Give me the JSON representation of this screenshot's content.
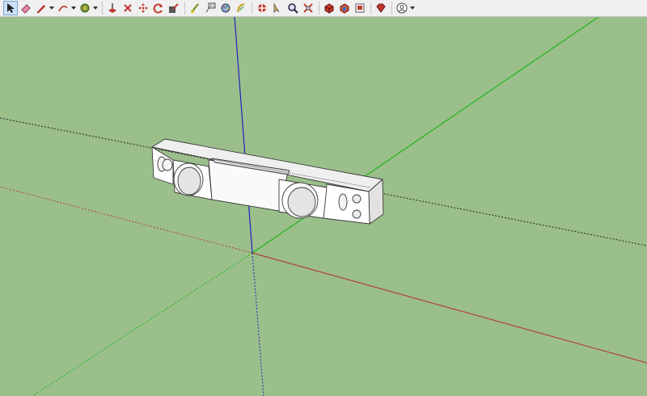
{
  "app": "SketchUp",
  "colors": {
    "background": "#9bbf8a",
    "red_axis": "#b0413e",
    "green_axis": "#1fb61f",
    "blue_axis": "#2222bb",
    "model_face": "#ffffff",
    "model_edge": "#3a3a3a"
  },
  "toolbar": {
    "tools": [
      {
        "id": "select",
        "icon": "arrow-cursor-icon",
        "selected": true
      },
      {
        "id": "eraser",
        "icon": "eraser-icon"
      },
      {
        "id": "line",
        "icon": "pencil-icon",
        "has_menu": true
      },
      {
        "id": "arc",
        "icon": "arc-icon",
        "has_menu": true
      },
      {
        "id": "paint",
        "icon": "paint-bucket-icon",
        "has_menu": true
      },
      {
        "id": "push-pull",
        "icon": "push-pull-icon"
      },
      {
        "id": "rotate",
        "icon": "rotate-icon"
      },
      {
        "id": "move",
        "icon": "move-icon"
      },
      {
        "id": "follow-me",
        "icon": "follow-me-icon"
      },
      {
        "id": "offset",
        "icon": "offset-icon"
      },
      {
        "id": "tape",
        "icon": "tape-measure-icon"
      },
      {
        "id": "text",
        "icon": "text-icon"
      },
      {
        "id": "axes",
        "icon": "axes-icon"
      },
      {
        "id": "orbit",
        "icon": "orbit-icon"
      },
      {
        "id": "pan",
        "icon": "pan-hand-icon"
      },
      {
        "id": "zoom",
        "icon": "zoom-icon"
      },
      {
        "id": "zoom-extents",
        "icon": "zoom-extents-icon"
      },
      {
        "id": "warehouse",
        "icon": "3d-warehouse-icon"
      },
      {
        "id": "extension",
        "icon": "extension-warehouse-icon"
      },
      {
        "id": "layout",
        "icon": "send-to-layout-icon"
      },
      {
        "id": "ruby",
        "icon": "ruby-console-icon"
      },
      {
        "id": "account",
        "icon": "user-account-icon",
        "has_menu": true
      }
    ]
  }
}
